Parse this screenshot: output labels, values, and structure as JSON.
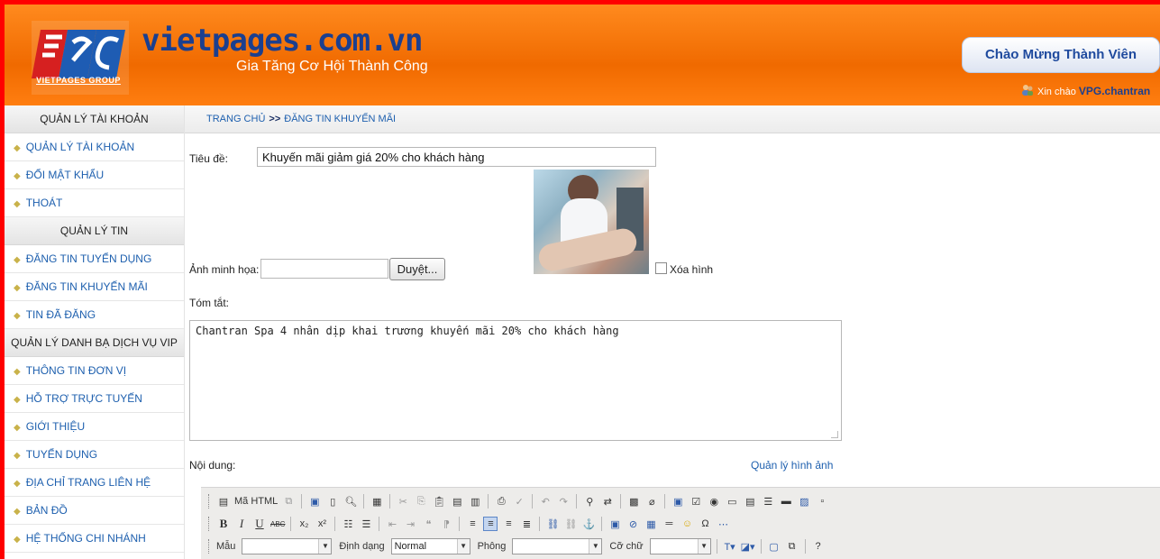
{
  "header": {
    "logo_text": "VPG",
    "logo_caption": "VIETPAGES GROUP",
    "site_name": "vietpages.com.vn",
    "slogan": "Gia Tăng Cơ Hội Thành Công",
    "welcome_button": "Chào Mừng Thành Viên",
    "hello_prefix": "Xin chào ",
    "username": "VPG.chantran"
  },
  "sidebar": {
    "section1": "QUẢN LÝ TÀI KHOẢN",
    "items1": [
      "QUẢN LÝ TÀI KHOẢN",
      "ĐỔI MẬT KHẨU",
      "THOÁT"
    ],
    "section2": "QUẢN LÝ TIN",
    "items2": [
      "ĐĂNG TIN TUYỂN DỤNG",
      "ĐĂNG TIN KHUYẾN MÃI",
      "TIN ĐÃ ĐĂNG"
    ],
    "section3": "QUẢN LÝ DANH BẠ DỊCH VỤ VIP",
    "items3": [
      "THÔNG TIN ĐƠN VỊ",
      "HỖ TRỢ TRỰC TUYẾN",
      "GIỚI THIỆU",
      "TUYỂN DỤNG",
      "ĐỊA CHỈ TRANG LIÊN HỆ",
      "BẢN ĐỒ",
      "HỆ THỐNG CHI NHÁNH"
    ]
  },
  "breadcrumb": {
    "home": "TRANG CHỦ",
    "separator": ">>",
    "current": "ĐĂNG TIN KHUYẾN MÃI"
  },
  "form": {
    "title_label": "Tiêu đề:",
    "title_value": "Khuyến mãi giảm giá 20% cho khách hàng",
    "image_label": "Ảnh minh họa:",
    "browse_label": "Duyệt...",
    "delete_image_label": "Xóa hình",
    "summary_label": "Tóm tắt:",
    "summary_value": "Chantran Spa 4 nhân dịp khai trương khuyến mãi 20% cho khách hàng",
    "content_label": "Nội dung:",
    "image_manager_link": "Quản lý hình ảnh"
  },
  "editor": {
    "html_button": "Mã HTML",
    "bold": "B",
    "italic": "I",
    "underline": "U",
    "style_label": "Mẫu",
    "style_value": "",
    "format_label": "Định dạng",
    "format_value": "Normal",
    "font_label": "Phông",
    "font_value": "",
    "size_label": "Cỡ chữ",
    "size_value": ""
  }
}
